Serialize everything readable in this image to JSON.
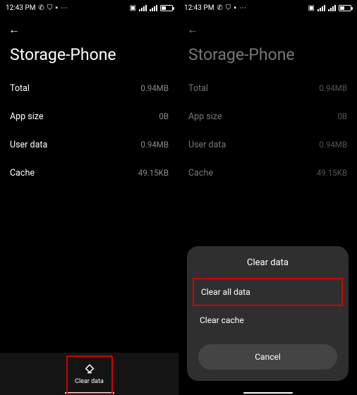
{
  "status": {
    "time": "12:43 PM",
    "icons_left": [
      "whatsapp-icon",
      "shield-icon",
      "lock-icon",
      "more-icon"
    ],
    "icons_right": [
      "cast-icon",
      "signal-icon",
      "signal-icon",
      "battery-icon"
    ]
  },
  "page": {
    "title": "Storage-Phone"
  },
  "rows": [
    {
      "label": "Total",
      "value": "0.94MB"
    },
    {
      "label": "App size",
      "value": "0B"
    },
    {
      "label": "User data",
      "value": "0.94MB"
    },
    {
      "label": "Cache",
      "value": "49.15KB"
    }
  ],
  "clear_button": {
    "label": "Clear data"
  },
  "sheet": {
    "title": "Clear data",
    "option_all": "Clear all data",
    "option_cache": "Clear cache",
    "cancel": "Cancel"
  }
}
